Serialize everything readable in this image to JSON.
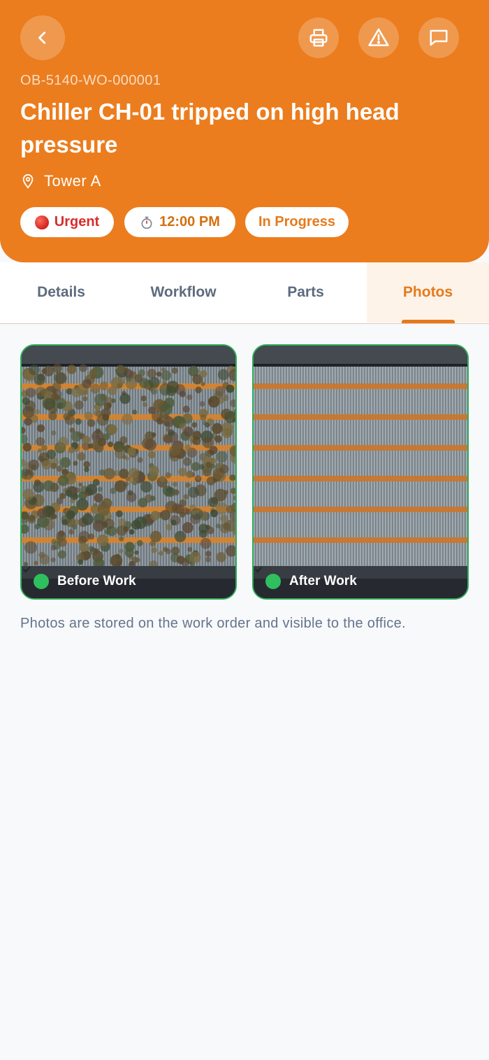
{
  "colors": {
    "brand": "#eb7d1e",
    "accent": "#e67a1b",
    "urgent": "#d62d2d",
    "success": "#2dad5b"
  },
  "header": {
    "back_icon": "chevron-left-icon",
    "actions": [
      "printer-icon",
      "warning-triangle-icon",
      "chat-bubble-icon"
    ],
    "work_order_id": "OB-5140-WO-000001",
    "title": "Chiller CH-01 tripped on high head pressure",
    "location_icon": "map-pin-icon",
    "location": "Tower A",
    "chips": {
      "priority": "Urgent",
      "time_icon": "stopwatch-icon",
      "time": "12:00 PM",
      "status": "In Progress"
    }
  },
  "tabs": [
    {
      "label": "Details",
      "active": false
    },
    {
      "label": "Workflow",
      "active": false
    },
    {
      "label": "Parts",
      "active": false
    },
    {
      "label": "Photos",
      "active": true
    }
  ],
  "photos": [
    {
      "label": "Before Work",
      "icon": "check-circle-icon"
    },
    {
      "label": "After Work",
      "icon": "check-circle-icon"
    }
  ],
  "note": "Photos are stored on the work order and visible to the office."
}
